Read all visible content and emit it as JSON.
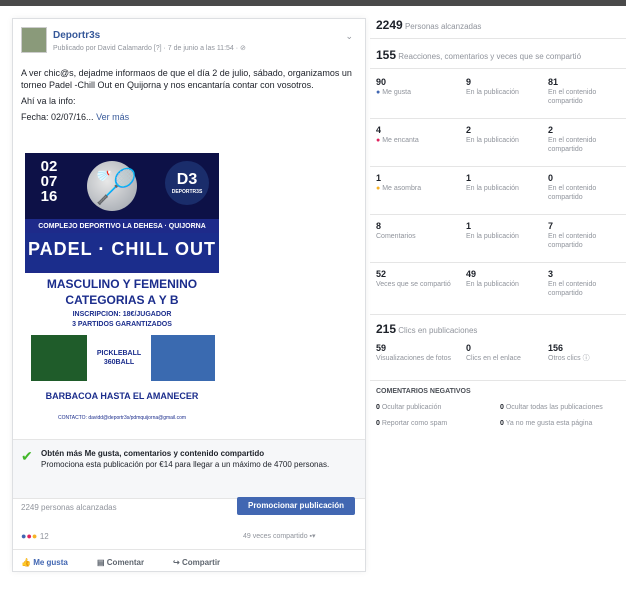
{
  "post": {
    "page_name": "Deportr3s",
    "meta": "Publicado por David Calamardo [?] · 7 de junio a las 11:54 · ⊘",
    "text": [
      "A ver chic@s, dejadme informaos de que el día 2 de julio, sábado, organizamos un torneo Padel -Chill Out en Quijorna y nos encantaría contar con vosotros.",
      "Ahí va la info:"
    ],
    "date_line": "Fecha: 02/07/16...",
    "see_more": "Ver más",
    "poster": {
      "date": "02\n07\n16",
      "logo": "D3",
      "logo_sub": "DEPORTR3S",
      "venue": "COMPLEJO DEPORTIVO LA DEHESA · QUIJORNA",
      "title": "PADEL · CHILL OUT",
      "line1": "MASCULINO Y FEMENINO",
      "line2": "CATEGORIAS A Y B",
      "line3": "INSCRIPCION: 18€/JUGADOR",
      "line4": "3 PARTIDOS GARANTIZADOS",
      "mid": "PICKLEBALL\n360BALL",
      "line5": "BARBACOA HASTA EL AMANECER",
      "contact": "CONTACTO: davidd@deportr3s/pdmquijorna@gmail.com"
    },
    "promo": {
      "headline": "Obtén más Me gusta, comentarios y contenido compartido",
      "body": "Promociona esta publicación por €14 para llegar a un máximo de 4700 personas."
    },
    "reached": "2249 personas alcanzadas",
    "promote_button": "Promocionar publicación",
    "reaction_count": "12",
    "shared": "49 veces compartido",
    "actions": {
      "like": "Me gusta",
      "comment": "Comentar",
      "share": "Compartir"
    }
  },
  "insights": {
    "reach_value": "2249",
    "reach_label": "Personas alcanzadas",
    "engagement_value": "155",
    "engagement_label": "Reacciones, comentarios y veces que se compartió",
    "rows": [
      {
        "total": "90",
        "label": "Me gusta",
        "icon": "like-icon",
        "in_post": "9",
        "in_shared": "81"
      },
      {
        "total": "4",
        "label": "Me encanta",
        "icon": "love-icon",
        "in_post": "2",
        "in_shared": "2"
      },
      {
        "total": "1",
        "label": "Me asombra",
        "icon": "wow-icon",
        "in_post": "1",
        "in_shared": "0"
      },
      {
        "total": "8",
        "label": "Comentarios",
        "icon": "",
        "in_post": "1",
        "in_shared": "7"
      },
      {
        "total": "52",
        "label": "Veces que se compartió",
        "icon": "",
        "in_post": "49",
        "in_shared": "3"
      }
    ],
    "in_post_label": "En la publicación",
    "in_shared_label": "En el contenido compartido",
    "clicks_value": "215",
    "clicks_label": "Clics en publicaciones",
    "click_cells": [
      {
        "n": "59",
        "label": "Visualizaciones de fotos"
      },
      {
        "n": "0",
        "label": "Clics en el enlace"
      },
      {
        "n": "156",
        "label": "Otros clics ⓘ"
      }
    ],
    "negative_title": "COMENTARIOS NEGATIVOS",
    "negatives": [
      {
        "n": "0",
        "label": "Ocultar publicación"
      },
      {
        "n": "0",
        "label": "Ocultar todas las publicaciones"
      },
      {
        "n": "0",
        "label": "Reportar como spam"
      },
      {
        "n": "0",
        "label": "Ya no me gusta esta página"
      }
    ]
  }
}
